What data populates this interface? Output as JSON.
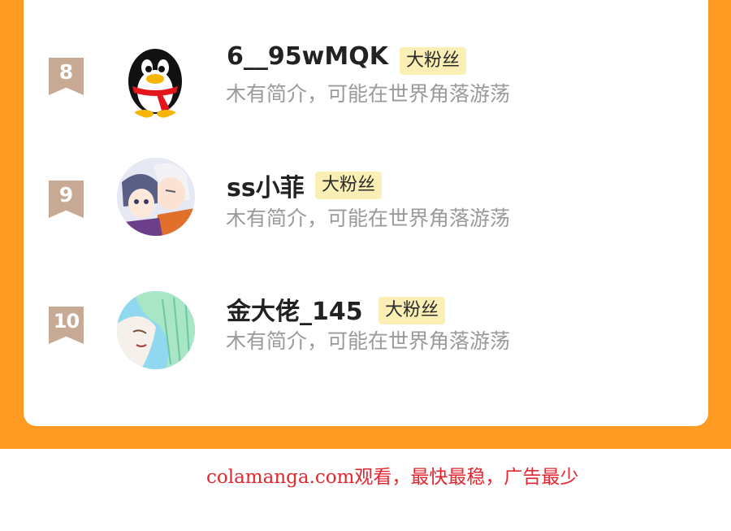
{
  "colors": {
    "background_accent": "#ff9a23",
    "card": "#ffffff",
    "rank_flag": "#c8aa94",
    "badge_bg": "#fcefb6",
    "username": "#222222",
    "intro": "#9a9a9a",
    "watermark": "#e3262f"
  },
  "fans": [
    {
      "rank": "8",
      "avatar": "qq-penguin-avatar",
      "username": "6__95wMQK",
      "badge": "大粉丝",
      "intro": "木有简介，可能在世界角落游荡"
    },
    {
      "rank": "9",
      "avatar": "anime-couple-avatar",
      "username": "ss小菲",
      "badge": "大粉丝",
      "intro": "木有简介，可能在世界角落游荡"
    },
    {
      "rank": "10",
      "avatar": "green-hair-anime-avatar",
      "username": "金大佬_145",
      "badge": "大粉丝",
      "intro": "木有简介，可能在世界角落游荡"
    }
  ],
  "watermark": "colamanga.com观看，最快最稳，广告最少"
}
